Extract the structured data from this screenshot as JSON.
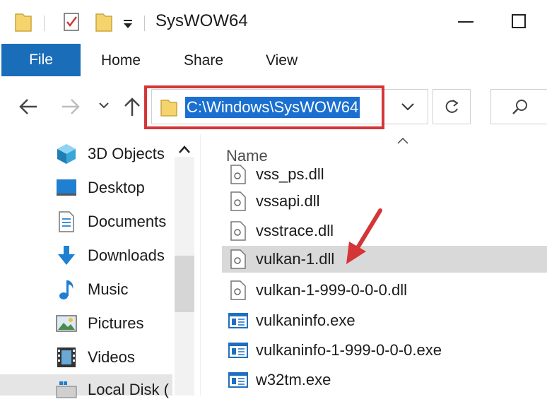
{
  "window": {
    "title": "SysWOW64"
  },
  "ribbon": {
    "tabs": [
      "File",
      "Home",
      "Share",
      "View"
    ]
  },
  "address": {
    "path": "C:\\Windows\\SysWOW64"
  },
  "nav_pane": {
    "items": [
      {
        "label": "3D Objects",
        "icon": "3d-objects-icon"
      },
      {
        "label": "Desktop",
        "icon": "desktop-icon"
      },
      {
        "label": "Documents",
        "icon": "documents-icon"
      },
      {
        "label": "Downloads",
        "icon": "downloads-icon"
      },
      {
        "label": "Music",
        "icon": "music-icon"
      },
      {
        "label": "Pictures",
        "icon": "pictures-icon"
      },
      {
        "label": "Videos",
        "icon": "videos-icon"
      },
      {
        "label": "Local Disk (",
        "icon": "local-disk-icon"
      }
    ]
  },
  "file_list": {
    "column_header": "Name",
    "rows": [
      {
        "name": "vss_ps.dll",
        "type": "dll"
      },
      {
        "name": "vssapi.dll",
        "type": "dll"
      },
      {
        "name": "vsstrace.dll",
        "type": "dll"
      },
      {
        "name": "vulkan-1.dll",
        "type": "dll",
        "selected": true
      },
      {
        "name": "vulkan-1-999-0-0-0.dll",
        "type": "dll"
      },
      {
        "name": "vulkaninfo.exe",
        "type": "exe"
      },
      {
        "name": "vulkaninfo-1-999-0-0-0.exe",
        "type": "exe"
      },
      {
        "name": "w32tm.exe",
        "type": "exe"
      }
    ]
  },
  "colors": {
    "file_tab": "#1a6db8",
    "address_highlight": "#1a6fd0",
    "annotation": "#d43638",
    "folder": "#f5d46e"
  }
}
